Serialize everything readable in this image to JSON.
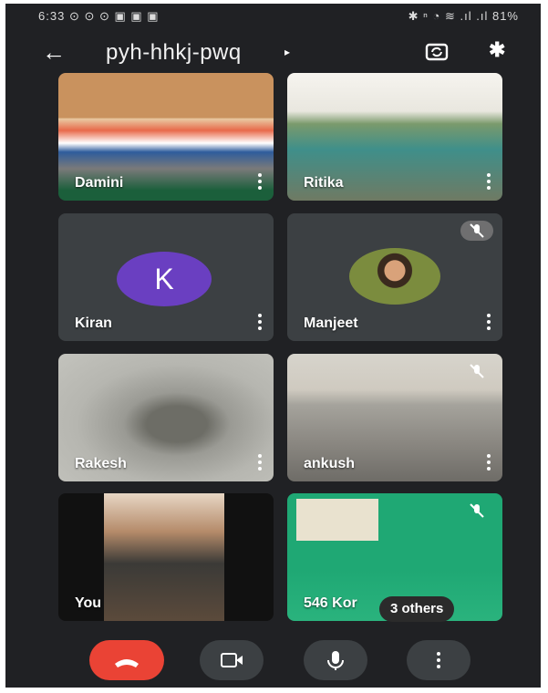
{
  "status_bar": {
    "time": "6:33",
    "left_icons": "⊙ ⊙ ⊙ ▣ ▣ ▣",
    "right_icons": "✱ ⁿ ◔ ≋ .ıl .ıl",
    "battery": "81%"
  },
  "meeting": {
    "code": "pyh-hhkj-pwq"
  },
  "participants": [
    {
      "name": "Damini"
    },
    {
      "name": "Ritika"
    },
    {
      "name": "Kiran",
      "initial": "K"
    },
    {
      "name": "Manjeet"
    },
    {
      "name": "Rakesh"
    },
    {
      "name": "ankush"
    },
    {
      "name": "You"
    },
    {
      "name": "546 Kor"
    }
  ],
  "others_badge": "3 others",
  "colors": {
    "end_call": "#ea4335",
    "avatar_bg": "#6a3fc1",
    "background": "#202124"
  },
  "icons": [
    "back-arrow-icon",
    "switch-camera-icon",
    "bluetooth-icon",
    "more-vert-icon",
    "mic-off-icon",
    "end-call-icon",
    "video-icon",
    "mic-icon"
  ]
}
